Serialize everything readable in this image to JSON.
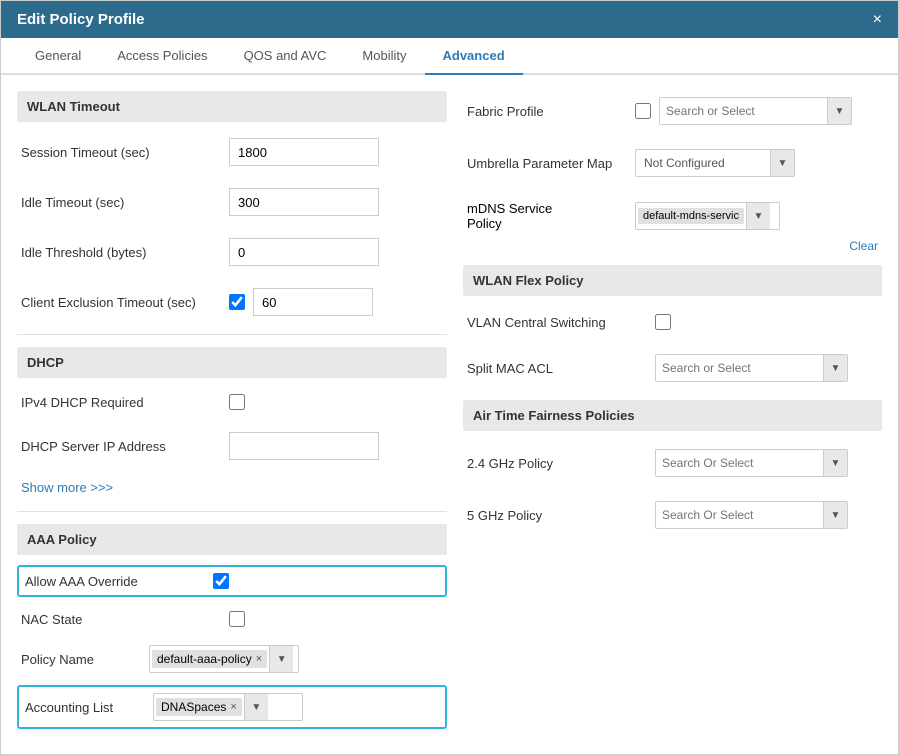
{
  "modal": {
    "title": "Edit Policy Profile",
    "close_label": "×"
  },
  "tabs": {
    "items": [
      {
        "id": "general",
        "label": "General",
        "active": false
      },
      {
        "id": "access-policies",
        "label": "Access Policies",
        "active": false
      },
      {
        "id": "qos-avc",
        "label": "QOS and AVC",
        "active": false
      },
      {
        "id": "mobility",
        "label": "Mobility",
        "active": false
      },
      {
        "id": "advanced",
        "label": "Advanced",
        "active": true
      }
    ]
  },
  "left": {
    "wlan_timeout_section": "WLAN Timeout",
    "session_timeout_label": "Session Timeout (sec)",
    "session_timeout_value": "1800",
    "idle_timeout_label": "Idle Timeout (sec)",
    "idle_timeout_value": "300",
    "idle_threshold_label": "Idle Threshold (bytes)",
    "idle_threshold_value": "0",
    "client_exclusion_label": "Client Exclusion Timeout (sec)",
    "client_exclusion_value": "60",
    "dhcp_section": "DHCP",
    "ipv4_dhcp_label": "IPv4 DHCP Required",
    "dhcp_server_label": "DHCP Server IP Address",
    "dhcp_server_value": "",
    "show_more_label": "Show more >>>",
    "aaa_section": "AAA Policy",
    "allow_aaa_label": "Allow AAA Override",
    "nac_state_label": "NAC State",
    "policy_name_label": "Policy Name",
    "policy_name_value": "default-aaa-policy",
    "accounting_list_label": "Accounting List",
    "accounting_list_value": "DNASpaces"
  },
  "right": {
    "fabric_profile_label": "Fabric Profile",
    "fabric_placeholder": "Search or Select",
    "umbrella_label": "Umbrella Parameter Map",
    "umbrella_value": "Not Configured",
    "mdns_label1": "mDNS Service",
    "mdns_label2": "Policy",
    "mdns_value": "default-mdns-servic",
    "clear_label": "Clear",
    "wlan_flex_section": "WLAN Flex Policy",
    "vlan_central_label": "VLAN Central Switching",
    "split_mac_label": "Split MAC ACL",
    "split_mac_placeholder": "Search or Select",
    "air_time_section": "Air Time Fairness Policies",
    "ghz_24_label": "2.4 GHz Policy",
    "ghz_24_placeholder": "Search Or Select",
    "ghz_5_label": "5 GHz Policy",
    "ghz_5_placeholder": "Search Or Select"
  },
  "icons": {
    "dropdown_arrow": "▼",
    "close": "✕",
    "tag_close": "×",
    "checkbox_checked": "✓"
  }
}
